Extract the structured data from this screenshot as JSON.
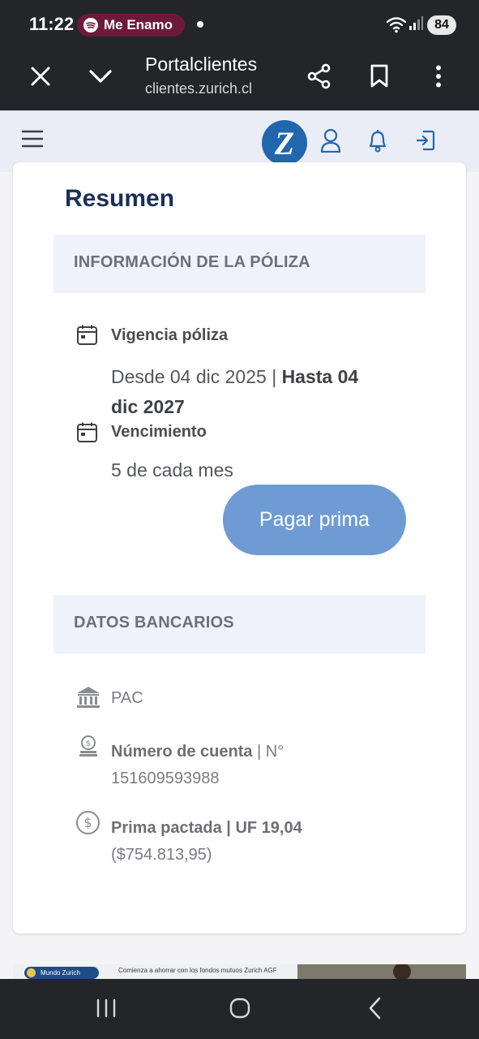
{
  "status_bar": {
    "time": "11:22",
    "media_app": "Me Enamo",
    "battery": "84"
  },
  "browser": {
    "title": "Portalclientes",
    "url": "clientes.zurich.cl"
  },
  "site": {
    "logo_letter": "Z"
  },
  "summary": {
    "title": "Resumen",
    "policy_section": {
      "header": "INFORMACIÓN DE LA PÓLIZA",
      "validity_label": "Vigencia póliza",
      "validity_from": "Desde 04 dic 2025 | ",
      "validity_to_line1": "Hasta 04",
      "validity_to_line2": "dic 2027",
      "due_label": "Vencimiento",
      "due_value": "5 de cada mes",
      "pay_button": "Pagar prima"
    },
    "bank_section": {
      "header": "DATOS BANCARIOS",
      "method": "PAC",
      "account_label": "Número de cuenta",
      "account_sep": " | N°",
      "account_number": "151609593988",
      "premium_label": "Prima pactada | UF 19,04",
      "premium_clp": "($754.813,95)"
    }
  },
  "ad": {
    "badge": "Mundo Zurich",
    "text": "Comienza a ahorrar con los fondos mutuos Zurich AGF"
  },
  "icons": {
    "close": "close-icon",
    "chevron": "chevron-down-icon",
    "share": "share-icon",
    "bookmark": "bookmark-icon",
    "more": "more-vertical-icon",
    "menu": "hamburger-menu-icon",
    "user": "user-icon",
    "bell": "bell-icon",
    "logout": "logout-icon",
    "calendar": "calendar-icon",
    "bank": "bank-icon",
    "coins": "coins-icon",
    "dollar": "dollar-circle-icon"
  },
  "colors": {
    "brand_blue": "#2167ae",
    "title_navy": "#1b2f57",
    "button_blue": "#6e9bd3",
    "section_bg": "#eff2fa",
    "system_bar": "#232528",
    "spotify_pill": "#6d1a3a"
  }
}
